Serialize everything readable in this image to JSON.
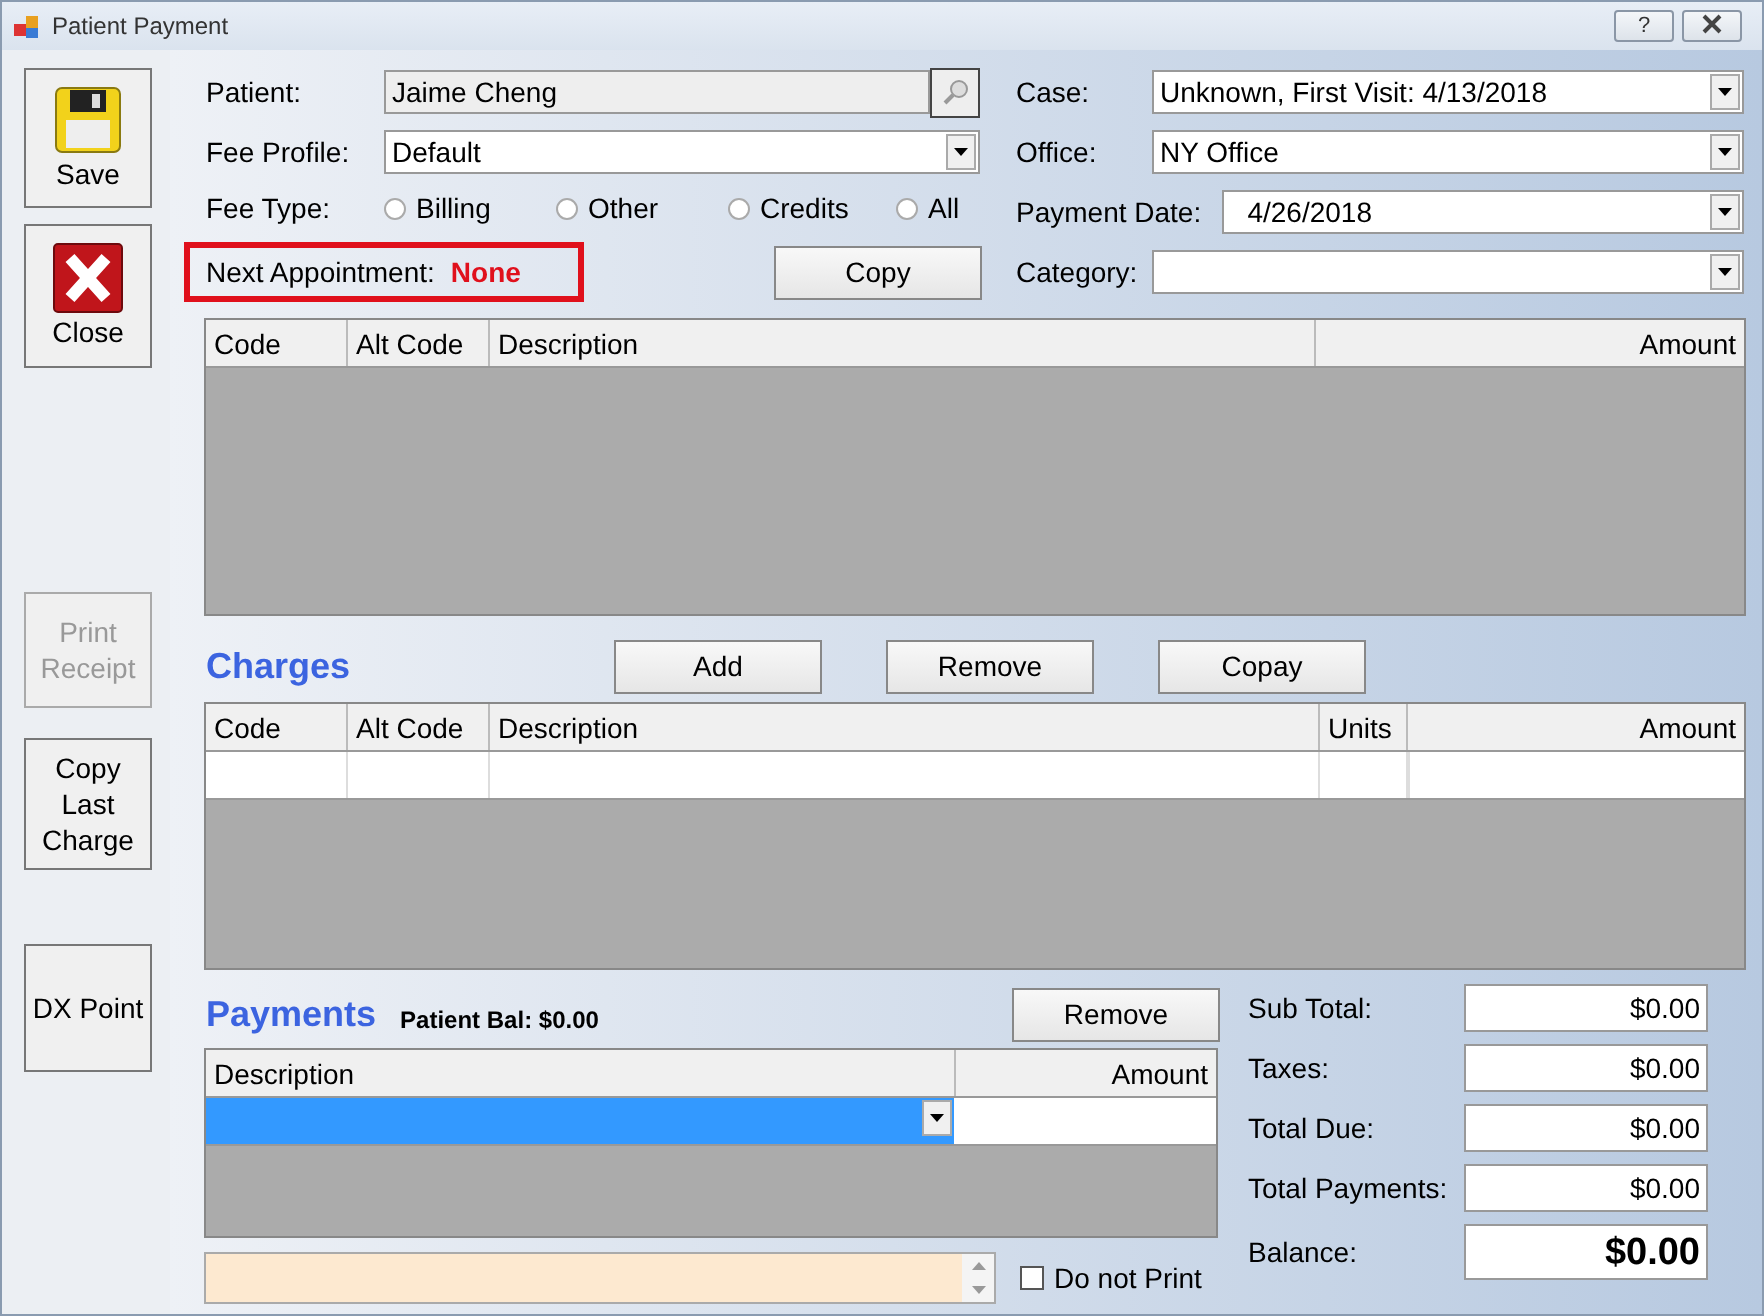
{
  "window": {
    "title": "Patient Payment",
    "buttons": [
      {
        "kind": "help",
        "label": "?"
      },
      {
        "kind": "close"
      }
    ]
  },
  "sidebar": [
    {
      "kind": "save",
      "label": "Save",
      "disabled": false
    },
    {
      "kind": "close",
      "label": "Close",
      "disabled": false
    },
    {
      "kind": "text",
      "label": "Print Receipt",
      "disabled": true
    },
    {
      "kind": "text",
      "label": "Copy Last Charge",
      "disabled": false
    },
    {
      "kind": "text",
      "label": "DX Point",
      "disabled": false
    }
  ],
  "form": {
    "patient": {
      "label": "Patient:",
      "value": "Jaime Cheng"
    },
    "fee_profile": {
      "label": "Fee Profile:",
      "value": "Default"
    },
    "fee_type": {
      "label": "Fee Type:",
      "options": [
        {
          "label": "Billing",
          "selected": false
        },
        {
          "label": "Other",
          "selected": false
        },
        {
          "label": "Credits",
          "selected": false
        },
        {
          "label": "All",
          "selected": false
        }
      ]
    },
    "next_appointment": {
      "label": "Next Appointment:",
      "value": "None"
    },
    "copy_button": "Copy",
    "case": {
      "label": "Case:",
      "value": "Unknown,  First Visit: 4/13/2018"
    },
    "office": {
      "label": "Office:",
      "value": "NY Office"
    },
    "payment_date": {
      "label": "Payment Date:",
      "value": "4/26/2018"
    },
    "category": {
      "label": "Category:"
    }
  },
  "codes_table": {
    "columns": [
      "Code",
      "Alt Code",
      "Description",
      "Amount"
    ]
  },
  "charges": {
    "title": "Charges",
    "buttons": [
      "Add",
      "Remove",
      "Copay"
    ],
    "columns": [
      "Code",
      "Alt Code",
      "Description",
      "Units",
      "Amount"
    ]
  },
  "payments": {
    "title": "Payments",
    "patient_balance": "Patient Bal: $0.00",
    "remove_button": "Remove",
    "columns": [
      "Description",
      "Amount"
    ],
    "rows": [
      {
        "selected": true
      }
    ],
    "do_not_print": {
      "label": "Do not Print",
      "checked": false
    }
  },
  "totals": [
    {
      "label": "Sub Total:",
      "value": "$0.00",
      "kind": "normal"
    },
    {
      "label": "Taxes:",
      "value": "$0.00",
      "kind": "normal"
    },
    {
      "label": "Total Due:",
      "value": "$0.00",
      "kind": "normal"
    },
    {
      "label": "Total Payments:",
      "value": "$0.00",
      "kind": "normal"
    },
    {
      "label": "Balance:",
      "value": "$0.00",
      "kind": "strong"
    }
  ]
}
